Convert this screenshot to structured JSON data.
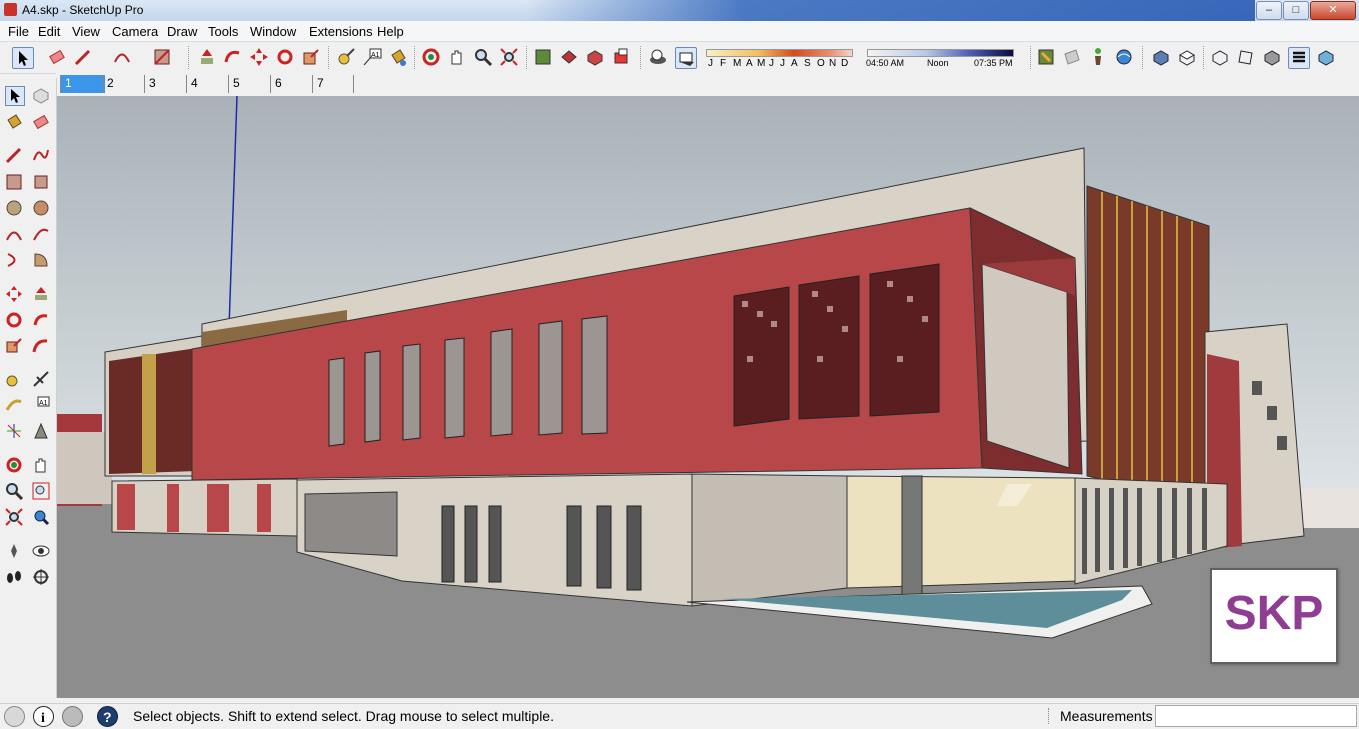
{
  "window": {
    "title": "A4.skp - SketchUp Pro",
    "minimize": "–",
    "maximize": "□",
    "close": "✕"
  },
  "menu": [
    "File",
    "Edit",
    "View",
    "Camera",
    "Draw",
    "Tools",
    "Window",
    "Extensions",
    "Help"
  ],
  "shadow_months": [
    "J",
    "F",
    "M",
    "A",
    "M",
    "J",
    "J",
    "A",
    "S",
    "O",
    "N",
    "D"
  ],
  "shadow_time": {
    "start": "04:50 AM",
    "noon": "Noon",
    "end": "07:35 PM"
  },
  "scenes": [
    "1",
    "2",
    "3",
    "4",
    "5",
    "6",
    "7"
  ],
  "active_scene": "1",
  "status": {
    "message": "Select objects. Shift to extend select. Drag mouse to select multiple.",
    "measurements_label": "Measurements",
    "measurements_value": ""
  },
  "badge": {
    "text": "SKP"
  },
  "colors": {
    "accent": "#3b95e8",
    "facade_red": "#b8474a",
    "badge_text": "#8f3d92"
  }
}
